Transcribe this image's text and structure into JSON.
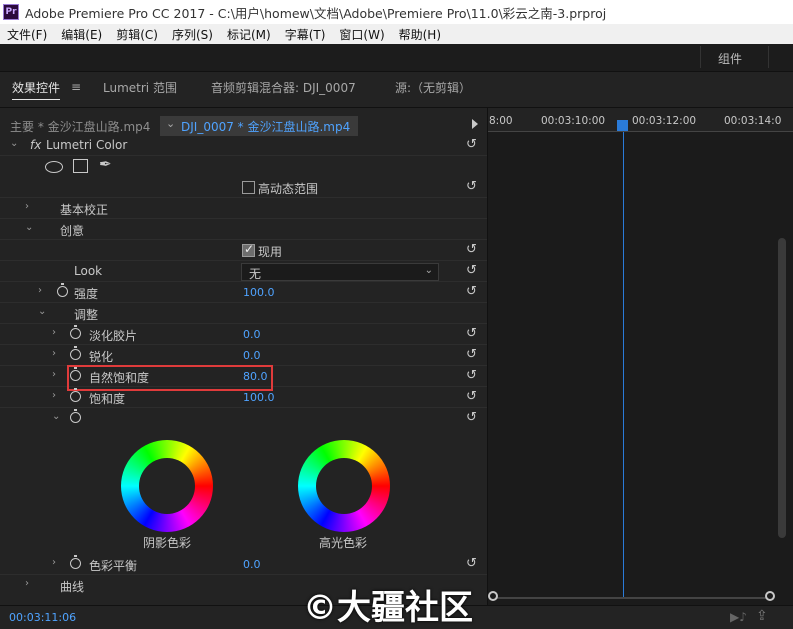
{
  "app": {
    "icon_text": "Pr",
    "title": "Adobe Premiere Pro CC 2017 - C:\\用户\\homew\\文档\\Adobe\\Premiere Pro\\11.0\\彩云之南-3.prproj"
  },
  "menu": [
    "文件(F)",
    "编辑(E)",
    "剪辑(C)",
    "序列(S)",
    "标记(M)",
    "字幕(T)",
    "窗口(W)",
    "帮助(H)"
  ],
  "workspace": {
    "components": "组件"
  },
  "tabs": [
    "效果控件",
    "Lumetri 范围",
    "音频剪辑混合器: DJI_0007",
    "源:（无剪辑）"
  ],
  "clip": {
    "master": "主要 * 金沙江盘山路.mp4",
    "sequence": "DJI_0007 * 金沙江盘山路.mp4"
  },
  "effect": {
    "name": "Lumetri Color",
    "hdr_label": "高动态范围",
    "basic": "基本校正",
    "creative": "创意",
    "enable_label": "现用",
    "look_label": "Look",
    "look_value": "无",
    "intensity_label": "强度",
    "intensity_value": "100.0",
    "adjust_label": "调整",
    "faded_label": "淡化胶片",
    "faded_value": "0.0",
    "sharpen_label": "锐化",
    "sharpen_value": "0.0",
    "vibrance_label": "自然饱和度",
    "vibrance_value": "80.0",
    "saturation_label": "饱和度",
    "saturation_value": "100.0",
    "shadow_tint": "阴影色彩",
    "highlight_tint": "高光色彩",
    "balance_label": "色彩平衡",
    "balance_value": "0.0",
    "curves_label": "曲线"
  },
  "timeline": {
    "ticks": [
      "8:00",
      "00:03:10:00",
      "00:03:12:00",
      "00:03:14:0"
    ]
  },
  "footer": {
    "timecode": "00:03:11:06"
  },
  "watermark": "©大疆社区",
  "colors": {
    "accent": "#4fa3ff",
    "highlight": "#e03b3b",
    "playhead": "#2a7bd9"
  }
}
